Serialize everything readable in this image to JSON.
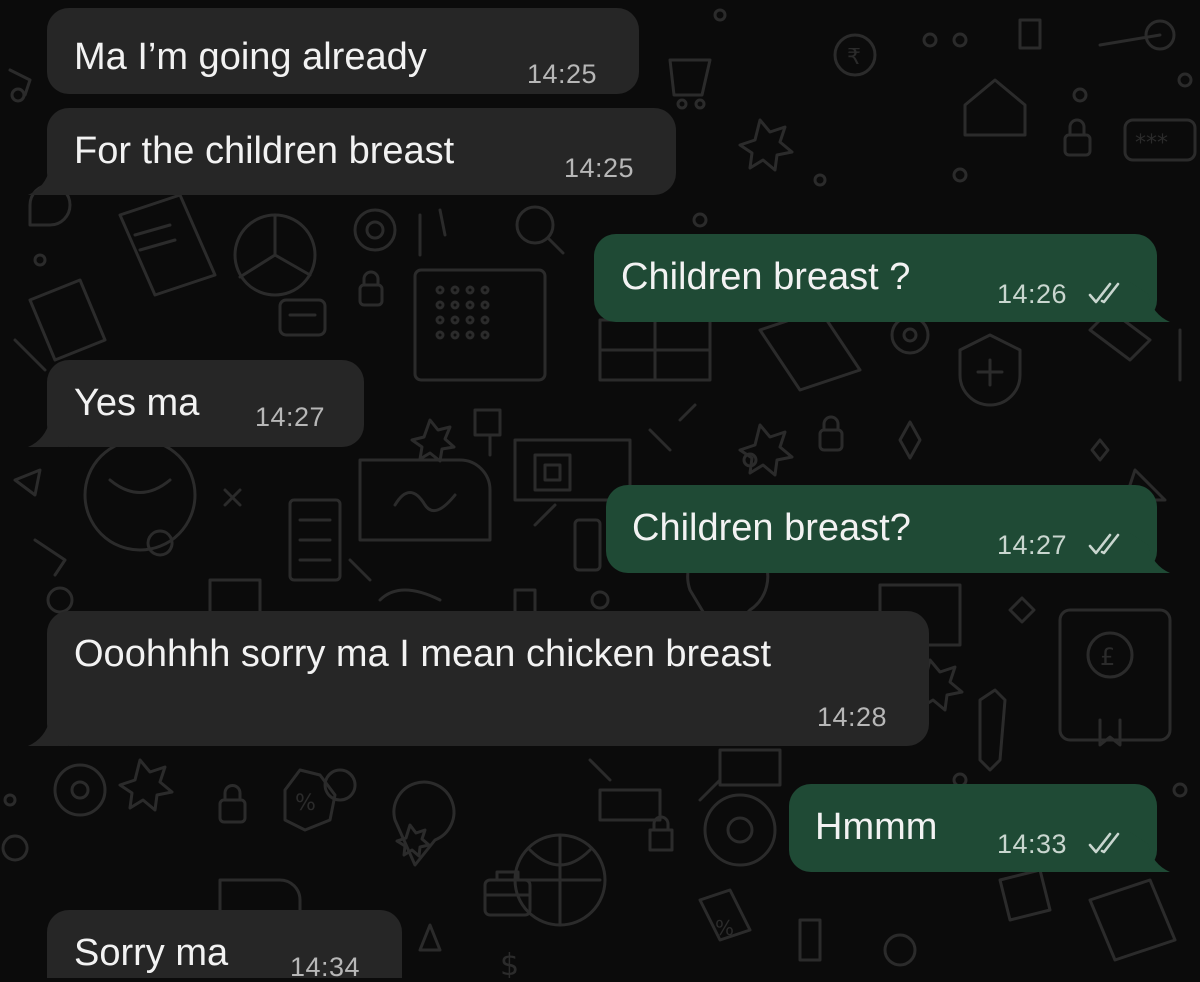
{
  "messages": [
    {
      "text": "Ma I’m going already",
      "time": "14:25",
      "direction": "incoming"
    },
    {
      "text": "For the children breast",
      "time": "14:25",
      "direction": "incoming"
    },
    {
      "text": "Children breast ?",
      "time": "14:26",
      "direction": "outgoing",
      "status": "read"
    },
    {
      "text": "Yes ma",
      "time": "14:27",
      "direction": "incoming"
    },
    {
      "text": "Children breast?",
      "time": "14:27",
      "direction": "outgoing",
      "status": "read"
    },
    {
      "text": "Ooohhhh sorry ma I mean chicken breast",
      "time": "14:28",
      "direction": "incoming"
    },
    {
      "text": "Hmmm",
      "time": "14:33",
      "direction": "outgoing",
      "status": "read"
    },
    {
      "text": "Sorry ma",
      "time": "14:34",
      "direction": "incoming"
    }
  ],
  "colors": {
    "background": "#0b0b0b",
    "incoming_bubble": "#262626",
    "outgoing_bubble": "#1f4a35",
    "text": "#f2f2f2",
    "timestamp": "#b7b7b7",
    "doodle": "#2a2a2a"
  },
  "icons": {
    "read_receipt": "double-check-icon",
    "wallpaper": "chat-doodle-pattern"
  }
}
